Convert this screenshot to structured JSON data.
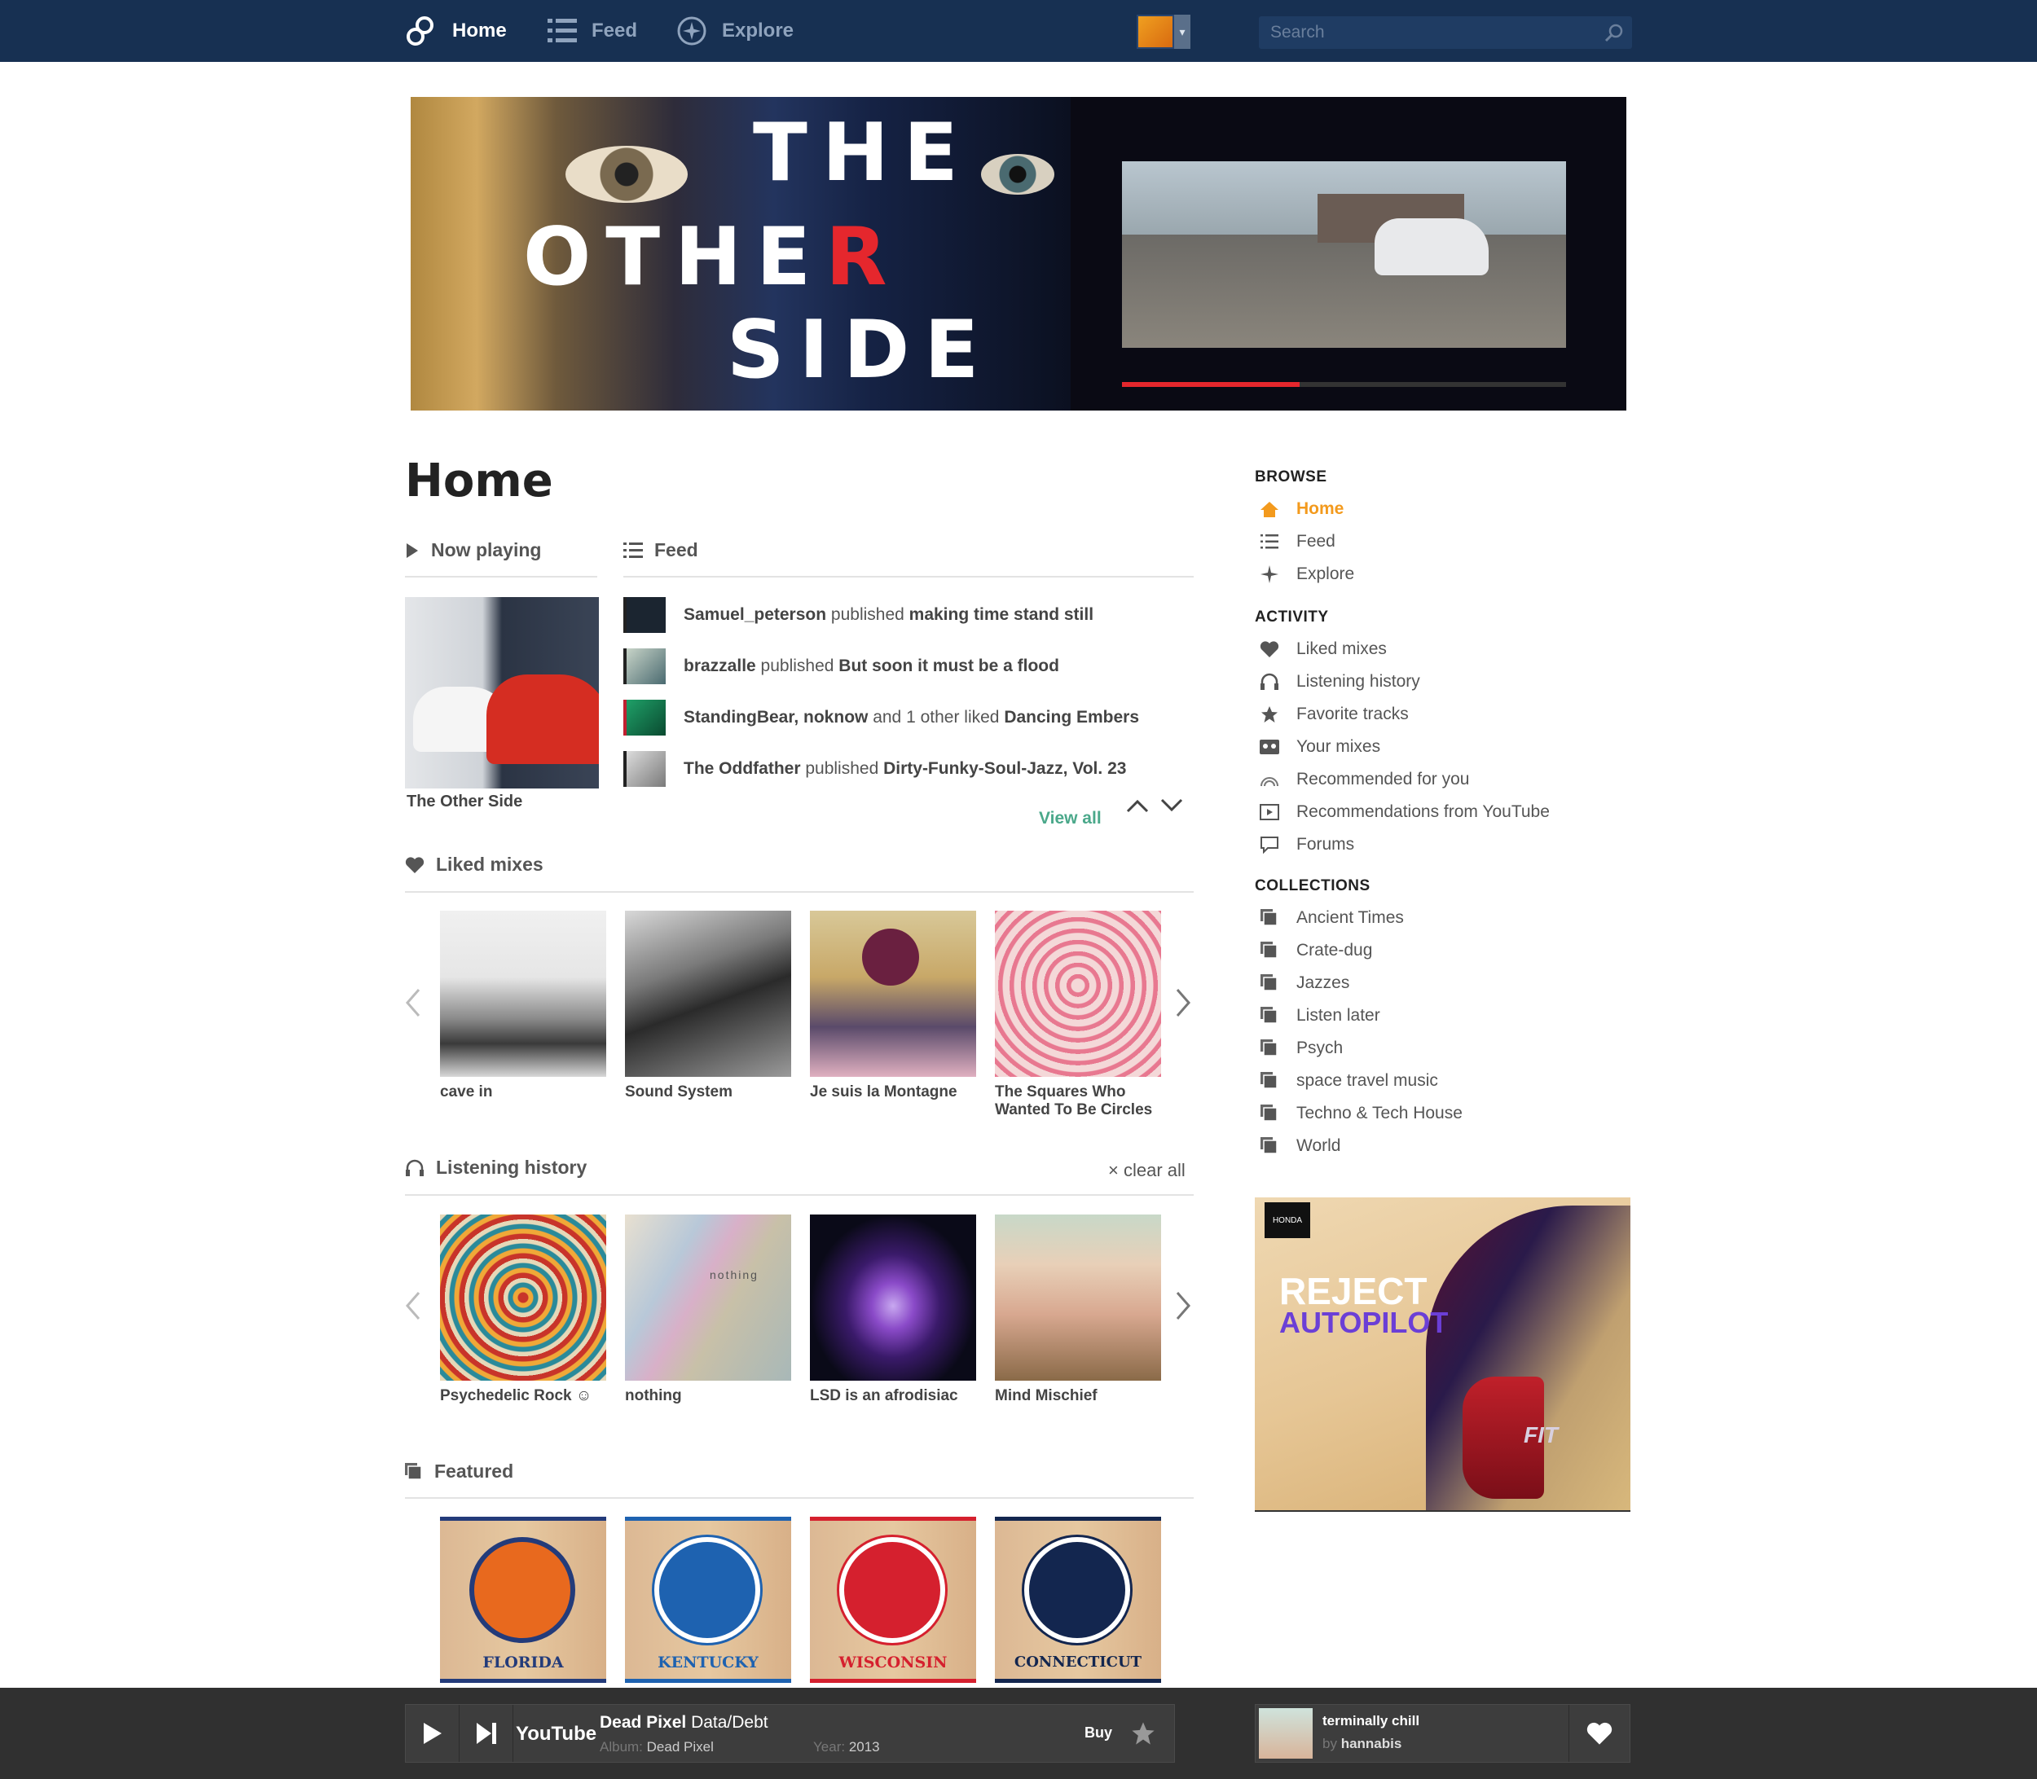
{
  "nav": {
    "home": "Home",
    "feed": "Feed",
    "explore": "Explore",
    "search_placeholder": "Search"
  },
  "banner": {
    "line1": "THE",
    "line2a": "OTHE",
    "line2b": "R",
    "line3": "SIDE"
  },
  "main": {
    "title": "Home",
    "now_playing": {
      "label": "Now playing",
      "mix_title": "The Other Side"
    },
    "feed": {
      "label": "Feed",
      "items": [
        {
          "actor": "Samuel_peterson",
          "verb": " published ",
          "object": "making time stand still",
          "color": "#1b2530"
        },
        {
          "actor": "brazzalle",
          "verb": " published ",
          "object": "But soon it must be a flood",
          "color": "#6f8a88"
        },
        {
          "actor": "StandingBear, noknow",
          "verb": " and 1 other liked ",
          "object": "Dancing Embers",
          "color": "#1fa068"
        },
        {
          "actor": "The Oddfather",
          "verb": " published ",
          "object": "Dirty-Funky-Soul-Jazz, Vol. 23",
          "color": "#9a9a9a"
        }
      ],
      "view_all": "View all"
    },
    "liked_mixes": {
      "label": "Liked mixes",
      "items": [
        {
          "title": "cave in"
        },
        {
          "title": "Sound System"
        },
        {
          "title": "Je suis la Montagne"
        },
        {
          "title_l1": "The Squares Who",
          "title_l2": "Wanted To Be Circles"
        }
      ]
    },
    "listening_history": {
      "label": "Listening history",
      "clear": "clear all",
      "items": [
        {
          "title": "Psychedelic Rock ☺"
        },
        {
          "title": "nothing",
          "overlay": "nothing"
        },
        {
          "title": "LSD is an afrodisiac"
        },
        {
          "title": "Mind Mischief"
        }
      ]
    },
    "featured": {
      "label": "Featured",
      "items": [
        {
          "name": "FLORIDA",
          "color": "#e8691e",
          "text_color": "#233b7a"
        },
        {
          "name": "KENTUCKY",
          "color": "#1e62b0",
          "text_color": "#1e62b0"
        },
        {
          "name": "WISCONSIN",
          "color": "#d5202e",
          "text_color": "#d5202e"
        },
        {
          "name": "CONNECTICUT",
          "color": "#13264f",
          "text_color": "#13264f"
        }
      ]
    }
  },
  "sidebar": {
    "browse": {
      "title": "BROWSE",
      "items": [
        {
          "label": "Home",
          "icon": "home-icon"
        },
        {
          "label": "Feed",
          "icon": "list-icon"
        },
        {
          "label": "Explore",
          "icon": "sparkle-icon"
        }
      ]
    },
    "activity": {
      "title": "ACTIVITY",
      "items": [
        {
          "label": "Liked mixes",
          "icon": "heart-icon"
        },
        {
          "label": "Listening history",
          "icon": "headphones-icon"
        },
        {
          "label": "Favorite tracks",
          "icon": "star-icon"
        },
        {
          "label": "Your mixes",
          "icon": "cassette-icon"
        },
        {
          "label": "Recommended for you",
          "icon": "rainbow-icon"
        },
        {
          "label": "Recommendations from YouTube",
          "icon": "play-box-icon"
        },
        {
          "label": "Forums",
          "icon": "chat-bubble-icon"
        }
      ]
    },
    "collections": {
      "title": "COLLECTIONS",
      "items": [
        {
          "label": "Ancient Times"
        },
        {
          "label": "Crate-dug"
        },
        {
          "label": "Jazzes"
        },
        {
          "label": "Listen later"
        },
        {
          "label": "Psych"
        },
        {
          "label": "space travel music"
        },
        {
          "label": "Techno & Tech House"
        },
        {
          "label": "World"
        }
      ]
    },
    "ad": {
      "brand": "HONDA",
      "line1": "REJECT",
      "line2": "AUTOPILOT",
      "model": "FIT"
    }
  },
  "player": {
    "youtube": "YouTube",
    "track": "Dead Pixel",
    "artist": "Data/Debt",
    "album_label": "Album:",
    "album": "Dead Pixel",
    "year_label": "Year:",
    "year": "2013",
    "buy": "Buy",
    "mix_title": "terminally chill",
    "mix_by": "by",
    "mix_author": "hannabis"
  }
}
